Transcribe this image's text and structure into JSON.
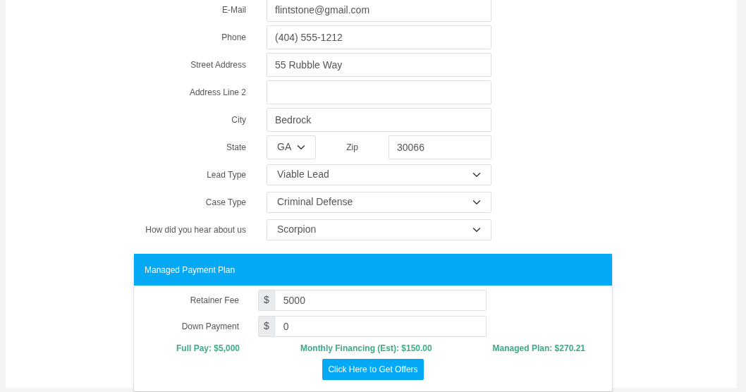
{
  "fields": [
    {
      "kind": "text",
      "label": "E-Mail",
      "value": "flintstone@gmail.com"
    },
    {
      "kind": "text",
      "label": "Phone",
      "value": "(404) 555-1212"
    },
    {
      "kind": "text",
      "label": "Street Address",
      "value": "55 Rubble Way"
    },
    {
      "kind": "text",
      "label": "Address Line 2"
    },
    {
      "kind": "text",
      "label": "City",
      "value": "Bedrock"
    },
    {
      "kind": "state_zip",
      "label": "State",
      "value": "GA",
      "zip_label": "Zip",
      "zip_value": "30066"
    },
    {
      "kind": "select",
      "label": "Lead Type",
      "value": "Viable Lead"
    },
    {
      "kind": "select",
      "label": "Case Type",
      "value": "Criminal Defense"
    },
    {
      "kind": "select",
      "label": "How did you hear about us",
      "value": "Scorpion"
    }
  ],
  "payment_plan": {
    "title": "Managed Payment Plan",
    "fields": [
      {
        "label": "Retainer Fee",
        "prefix": "$",
        "value": "5000"
      },
      {
        "label": "Down Payment",
        "prefix": "$",
        "value": "0"
      }
    ],
    "summary": [
      "Full Pay: $5,000",
      "Monthly Financing (Est): $150.00",
      "Managed Plan: $270.21"
    ],
    "button": "Click Here to Get Offers"
  }
}
